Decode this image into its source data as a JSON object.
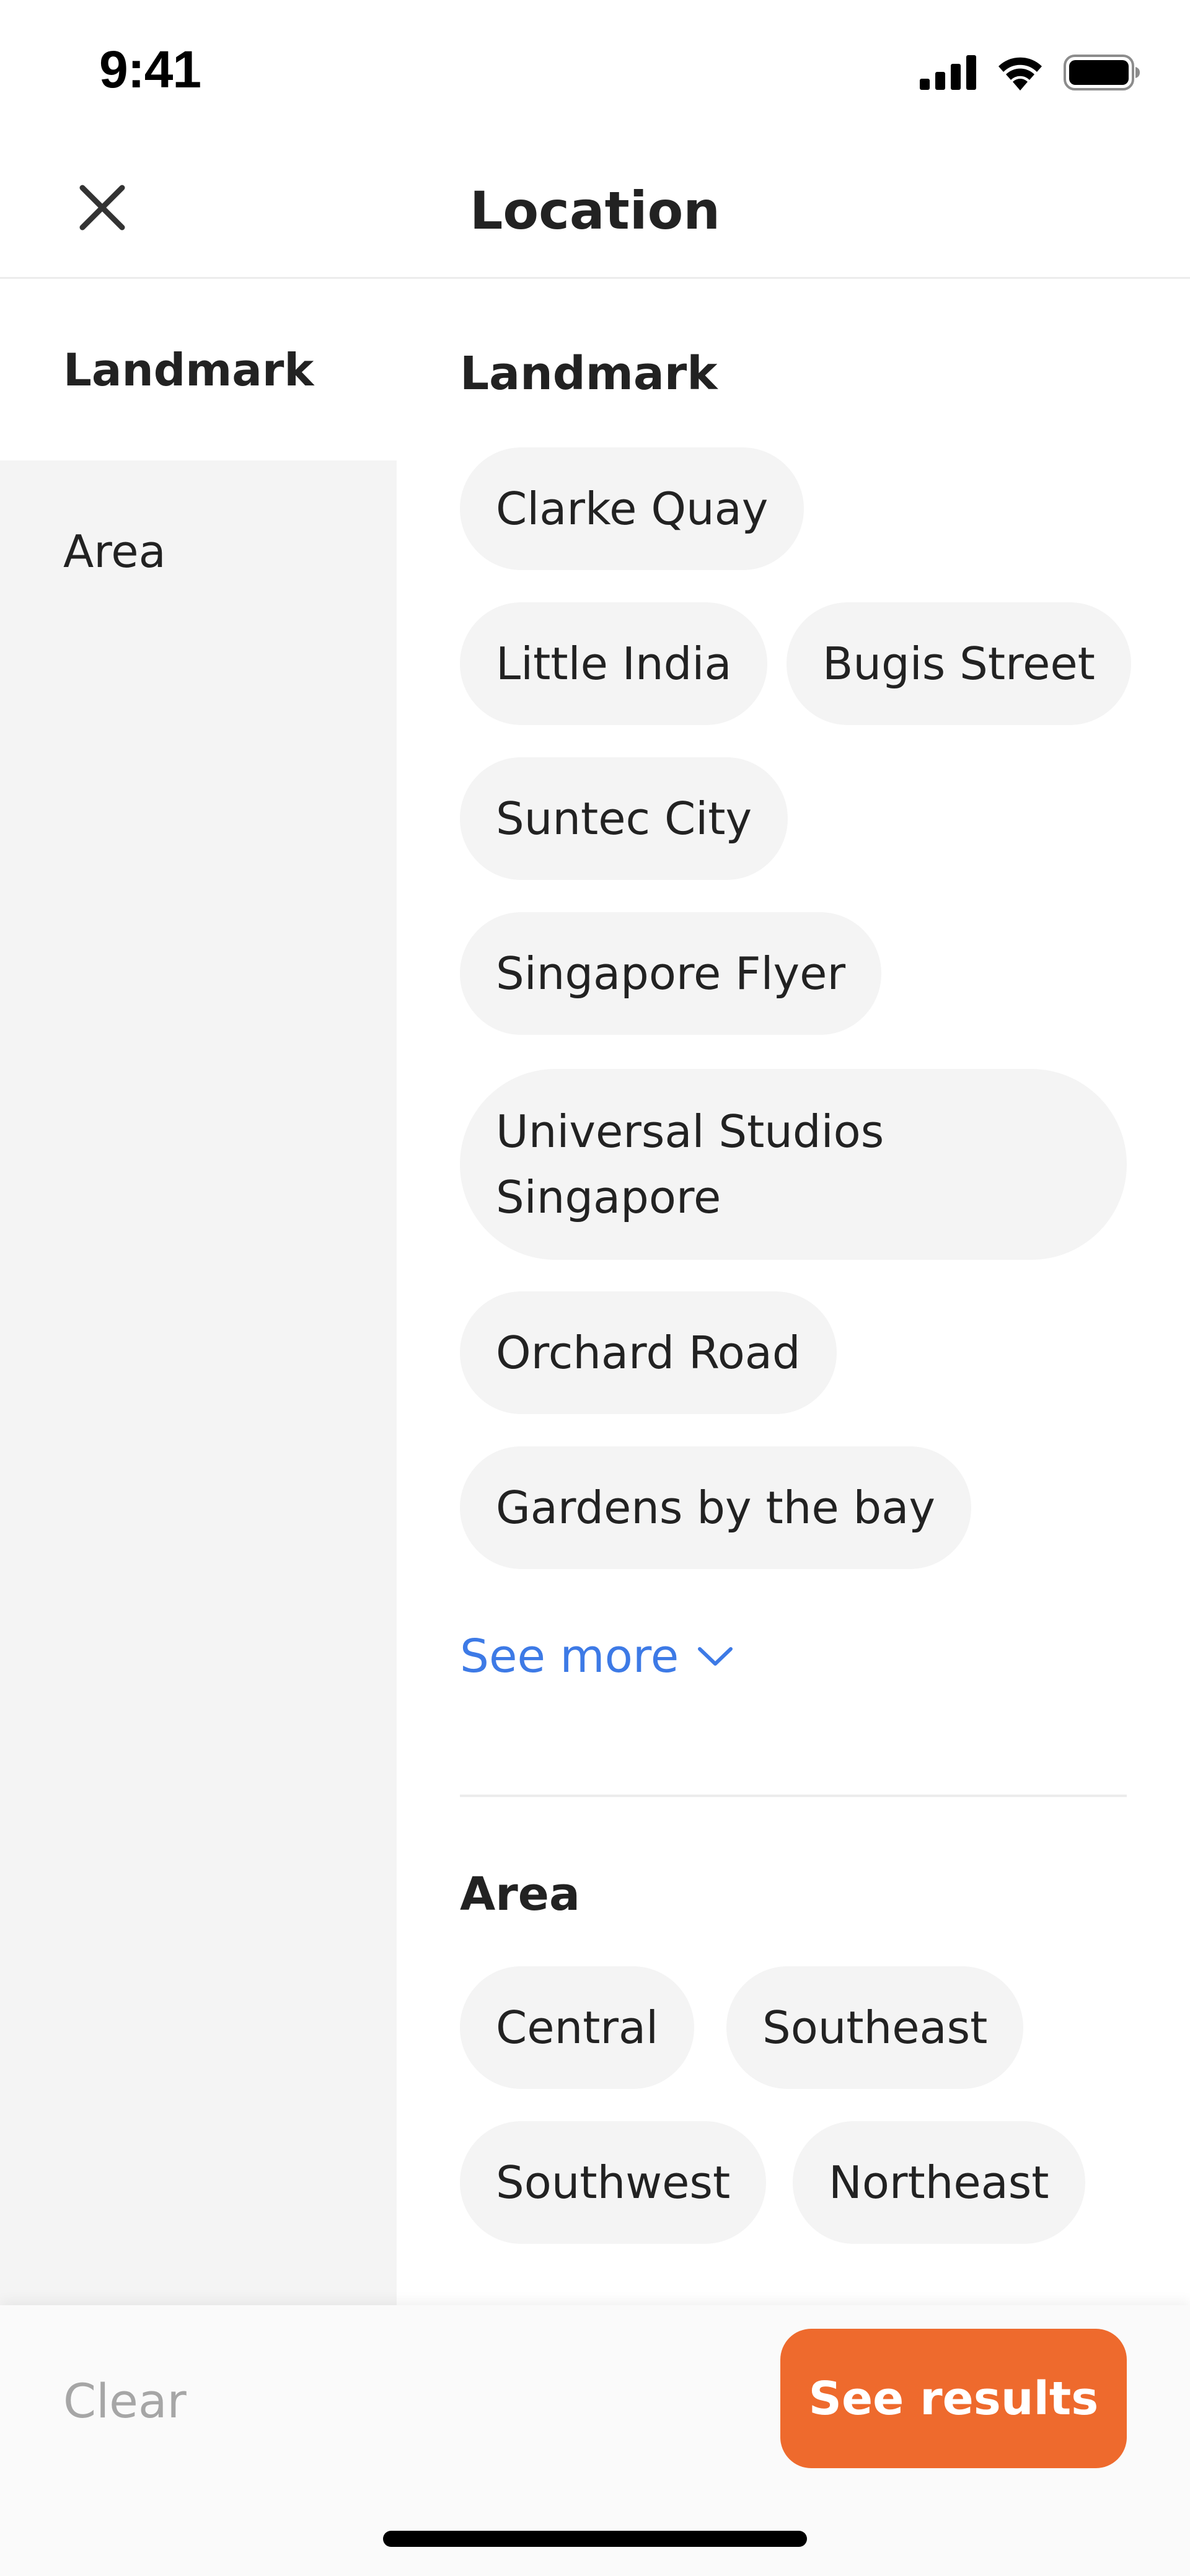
{
  "status_bar": {
    "time": "9:41",
    "icons": [
      "cellular-signal-icon",
      "wifi-icon",
      "battery-icon"
    ]
  },
  "header": {
    "title": "Location",
    "close_icon": "close-icon"
  },
  "sidebar": {
    "items": [
      {
        "label": "Landmark",
        "active": true
      },
      {
        "label": "Area",
        "active": false
      }
    ]
  },
  "landmark": {
    "title": "Landmark",
    "chips": [
      "Clarke Quay",
      "Little India",
      "Bugis Street",
      "Suntec City",
      "Singapore Flyer",
      "Universal Studios Singapore",
      "Orchard Road",
      "Gardens by the bay"
    ],
    "see_more": "See more",
    "see_more_icon": "chevron-down-icon"
  },
  "area": {
    "title": "Area",
    "chips": [
      "Central",
      "Southeast",
      "Southwest",
      "Northeast"
    ]
  },
  "footer": {
    "clear_label": "Clear",
    "results_label": "See results"
  },
  "colors": {
    "accent": "#ee6a2d",
    "link": "#3d7ae6",
    "chip_bg": "#f4f4f4",
    "sidebar_bg": "#f4f4f4",
    "muted_text": "#a6a6a6"
  }
}
